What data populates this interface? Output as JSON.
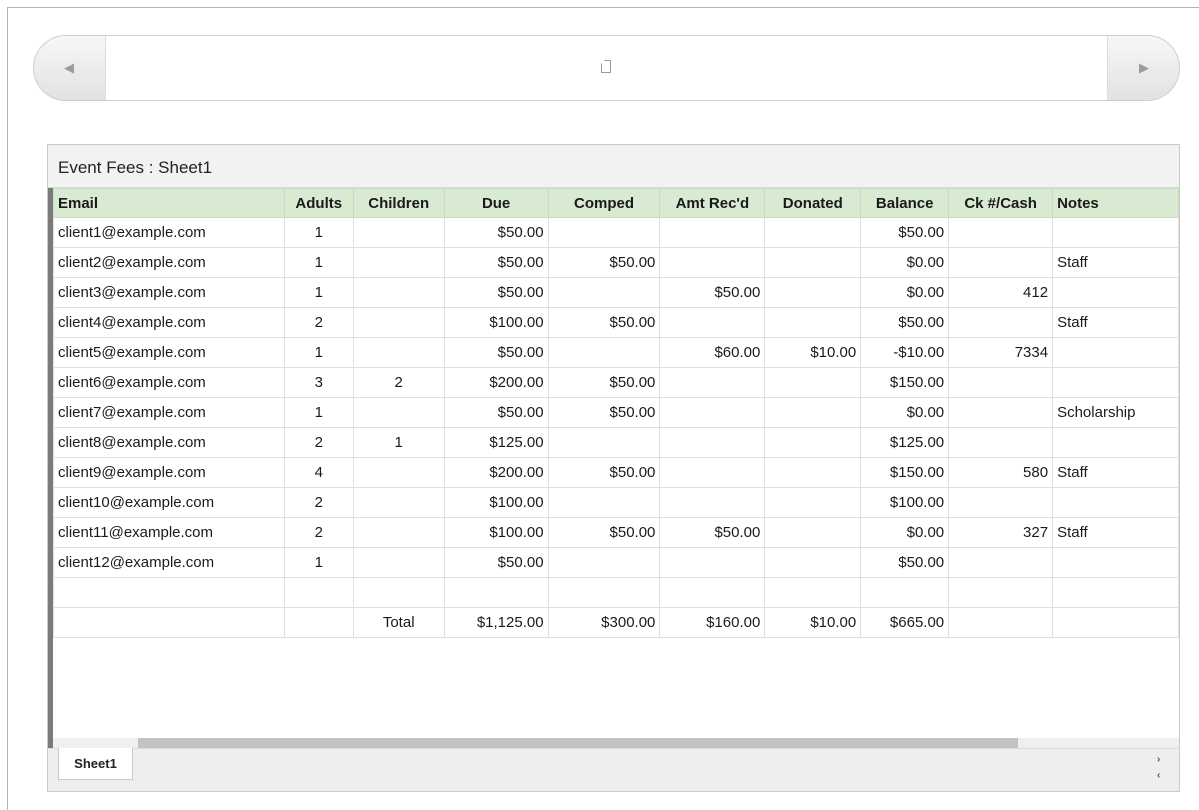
{
  "nav": {
    "prev_icon": "triangle-left-icon",
    "next_icon": "triangle-right-icon",
    "page_icon": "page-icon"
  },
  "sheet": {
    "title": "Event Fees : Sheet1",
    "columns": [
      "Email",
      "Adults",
      "Children",
      "Due",
      "Comped",
      "Amt Rec'd",
      "Donated",
      "Balance",
      "Ck #/Cash",
      "Notes"
    ],
    "rows": [
      [
        "client1@example.com",
        "1",
        "",
        "$50.00",
        "",
        "",
        "",
        "$50.00",
        "",
        ""
      ],
      [
        "client2@example.com",
        "1",
        "",
        "$50.00",
        "$50.00",
        "",
        "",
        "$0.00",
        "",
        "Staff"
      ],
      [
        "client3@example.com",
        "1",
        "",
        "$50.00",
        "",
        "$50.00",
        "",
        "$0.00",
        "412",
        ""
      ],
      [
        "client4@example.com",
        "2",
        "",
        "$100.00",
        "$50.00",
        "",
        "",
        "$50.00",
        "",
        "Staff"
      ],
      [
        "client5@example.com",
        "1",
        "",
        "$50.00",
        "",
        "$60.00",
        "$10.00",
        "-$10.00",
        "7334",
        ""
      ],
      [
        "client6@example.com",
        "3",
        "2",
        "$200.00",
        "$50.00",
        "",
        "",
        "$150.00",
        "",
        ""
      ],
      [
        "client7@example.com",
        "1",
        "",
        "$50.00",
        "$50.00",
        "",
        "",
        "$0.00",
        "",
        "Scholarship"
      ],
      [
        "client8@example.com",
        "2",
        "1",
        "$125.00",
        "",
        "",
        "",
        "$125.00",
        "",
        ""
      ],
      [
        "client9@example.com",
        "4",
        "",
        "$200.00",
        "$50.00",
        "",
        "",
        "$150.00",
        "580",
        "Staff"
      ],
      [
        "client10@example.com",
        "2",
        "",
        "$100.00",
        "",
        "",
        "",
        "$100.00",
        "",
        ""
      ],
      [
        "client11@example.com",
        "2",
        "",
        "$100.00",
        "$50.00",
        "$50.00",
        "",
        "$0.00",
        "327",
        "Staff"
      ],
      [
        "client12@example.com",
        "1",
        "",
        "$50.00",
        "",
        "",
        "",
        "$50.00",
        "",
        ""
      ],
      [
        "",
        "",
        "",
        "",
        "",
        "",
        "",
        "",
        "",
        ""
      ],
      [
        "",
        "",
        "Total",
        "$1,125.00",
        "$300.00",
        "$160.00",
        "$10.00",
        "$665.00",
        "",
        ""
      ]
    ],
    "header_color": "#d9ead3"
  },
  "tabs": {
    "active": "Sheet1",
    "scroll_right": "›",
    "scroll_left": "‹"
  }
}
